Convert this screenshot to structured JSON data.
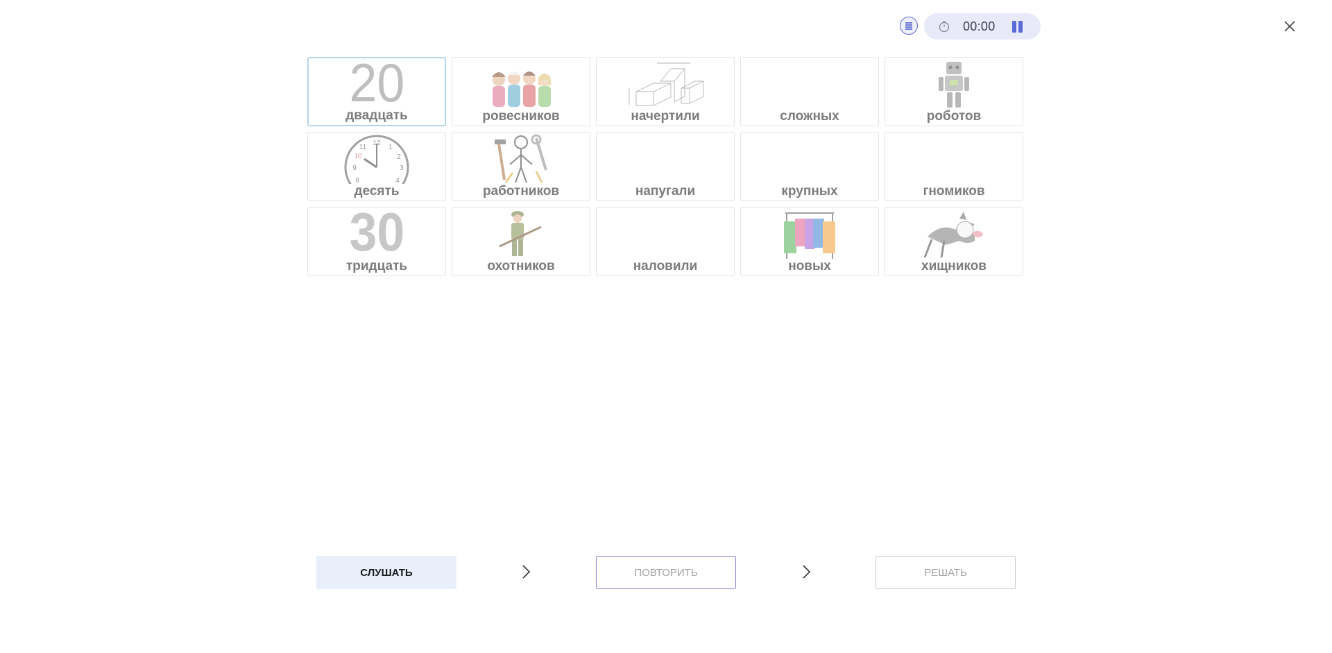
{
  "header": {
    "timer": "00:00",
    "icons": {
      "list": "list-icon",
      "stopwatch": "stopwatch-icon",
      "pause": "pause-icon",
      "close": "close-icon"
    }
  },
  "cards": [
    {
      "label": "двадцать",
      "picture": "number-20",
      "number": "20",
      "selected": true
    },
    {
      "label": "ровесников",
      "picture": "group-of-friends"
    },
    {
      "label": "начертили",
      "picture": "technical-drawing"
    },
    {
      "label": "сложных",
      "picture": ""
    },
    {
      "label": "роботов",
      "picture": "robot"
    },
    {
      "label": "десять",
      "picture": "clock-ten"
    },
    {
      "label": "работников",
      "picture": "worker-tools"
    },
    {
      "label": "напугали",
      "picture": ""
    },
    {
      "label": "крупных",
      "picture": ""
    },
    {
      "label": "гномиков",
      "picture": ""
    },
    {
      "label": "тридцать",
      "picture": "number-30",
      "number": "30"
    },
    {
      "label": "охотников",
      "picture": "hunter"
    },
    {
      "label": "наловили",
      "picture": ""
    },
    {
      "label": "новых",
      "picture": "clothes-rack"
    },
    {
      "label": "хищников",
      "picture": "predator-animal"
    }
  ],
  "footer": {
    "listen_label": "СЛУШАТЬ",
    "repeat_label": "ПОВТОРИТЬ",
    "solve_label": "РЕШАТЬ"
  },
  "colors": {
    "accent": "#5b6bd6",
    "pill_bg": "#e8eaf9",
    "listen_bg": "#e8effb",
    "repeat_border": "#8d78d6"
  }
}
